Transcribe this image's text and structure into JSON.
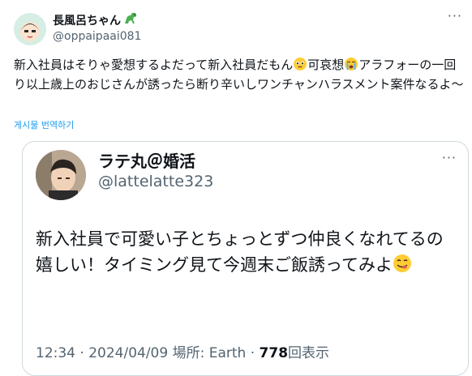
{
  "tweet": {
    "display_name": "長風呂ちゃん",
    "name_emoji": "dinosaur-icon",
    "handle": "@oppaipaai081",
    "text_part1": "新入社員はそりゃ愛想するよだって新入社員だもん",
    "emoji1": "pleading-face-icon",
    "text_part2": "可哀想",
    "emoji2": "crying-face-icon",
    "text_part3": "アラフォーの一回り以上歳上のおじさんが誘ったら断り辛いしワンチャンハラスメント案件なるよ〜",
    "translate_label": "게시물 번역하기",
    "more": "···"
  },
  "quoted": {
    "display_name": "ラテ丸＠婚活",
    "handle": "@lattelatte323",
    "text": "新入社員で可愛い子とちょっとずつ仲良くなれてるの嬉しい！タイミング見て今週末ご飯誘ってみよ",
    "emoji": "yum-face-icon",
    "time": "12:34 · 2024/04/09 場所: Earth · ",
    "views": "778",
    "views_label": "回表示",
    "more": "···"
  }
}
